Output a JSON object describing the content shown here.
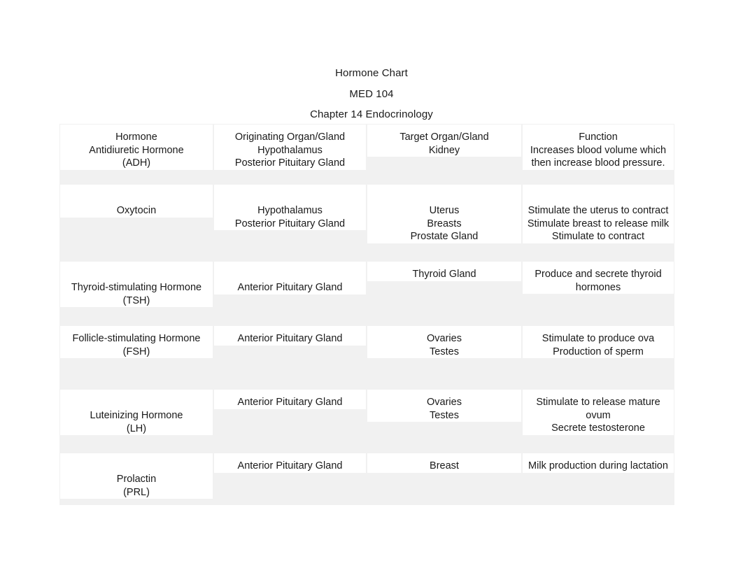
{
  "document": {
    "title": "Hormone Chart",
    "course": "MED 104",
    "chapter": "Chapter 14 Endocrinology"
  },
  "table": {
    "columns": [
      "Hormone",
      "Originating Organ/Gland",
      "Target Organ/Gland",
      "Function"
    ],
    "rows": [
      {
        "hormone": [
          "Antidiuretic Hormone",
          "(ADH)"
        ],
        "origin": [
          "Hypothalamus",
          "Posterior Pituitary Gland"
        ],
        "target": [
          "Kidney"
        ],
        "function": [
          "Increases blood volume which",
          "then increase blood pressure."
        ]
      },
      {
        "hormone": [
          "Oxytocin"
        ],
        "origin": [
          "Hypothalamus",
          "Posterior Pituitary Gland"
        ],
        "target": [
          "Uterus",
          "Breasts",
          "Prostate Gland"
        ],
        "function": [
          "Stimulate the uterus to contract",
          "Stimulate breast to release milk",
          "Stimulate to contract"
        ]
      },
      {
        "hormone": [
          "Thyroid-stimulating Hormone",
          "(TSH)"
        ],
        "origin": [
          "Anterior Pituitary Gland"
        ],
        "target": [
          "Thyroid Gland"
        ],
        "function": [
          "Produce and secrete thyroid",
          "hormones"
        ]
      },
      {
        "hormone": [
          "Follicle-stimulating Hormone",
          "(FSH)"
        ],
        "origin": [
          "Anterior Pituitary Gland"
        ],
        "target": [
          "Ovaries",
          "Testes"
        ],
        "function": [
          "Stimulate to produce ova",
          "Production of sperm"
        ]
      },
      {
        "hormone": [
          "Luteinizing Hormone",
          "(LH)"
        ],
        "origin": [
          "Anterior Pituitary Gland"
        ],
        "target": [
          "Ovaries",
          "Testes"
        ],
        "function": [
          "Stimulate to release mature",
          "ovum",
          "Secrete testosterone"
        ]
      },
      {
        "hormone": [
          "Prolactin",
          "(PRL)"
        ],
        "origin": [
          "Anterior Pituitary Gland"
        ],
        "target": [
          "Breast"
        ],
        "function": [
          "Milk production during lactation"
        ]
      }
    ]
  },
  "colors": {
    "page_background": "#ffffff",
    "table_background": "#f1f1f1",
    "cell_background": "#ffffff",
    "text": "#1a1a1a"
  }
}
